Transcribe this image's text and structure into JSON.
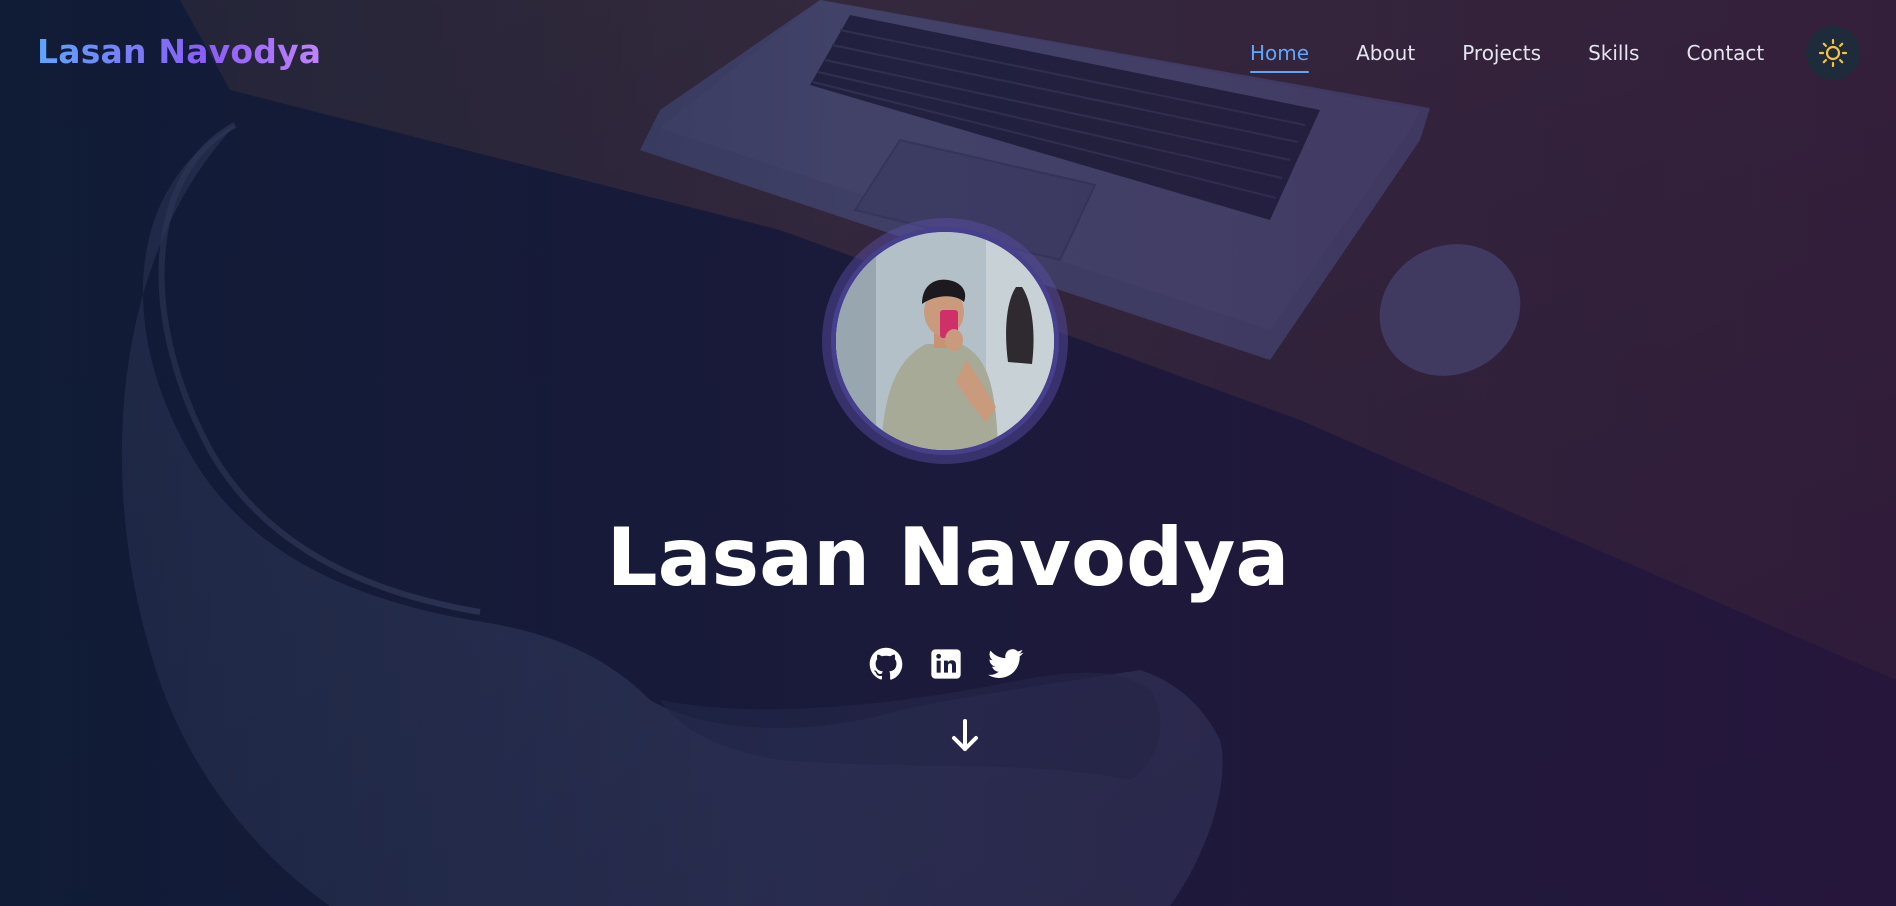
{
  "navbar": {
    "brand": "Lasan Navodya",
    "links": [
      {
        "label": "Home",
        "active": true
      },
      {
        "label": "About",
        "active": false
      },
      {
        "label": "Projects",
        "active": false
      },
      {
        "label": "Skills",
        "active": false
      },
      {
        "label": "Contact",
        "active": false
      }
    ],
    "theme_toggle_icon": "sun-icon"
  },
  "hero": {
    "name": "Lasan Navodya",
    "avatar": "profile-photo",
    "socials": [
      "github-icon",
      "linkedin-icon",
      "twitter-icon"
    ],
    "scroll_icon": "arrow-down-icon"
  },
  "colors": {
    "accent": "#60a5fa",
    "brand_gradient_start": "#60a5fa",
    "brand_gradient_end": "#c084fc",
    "sun": "#f5c242",
    "text": "#ffffff"
  }
}
